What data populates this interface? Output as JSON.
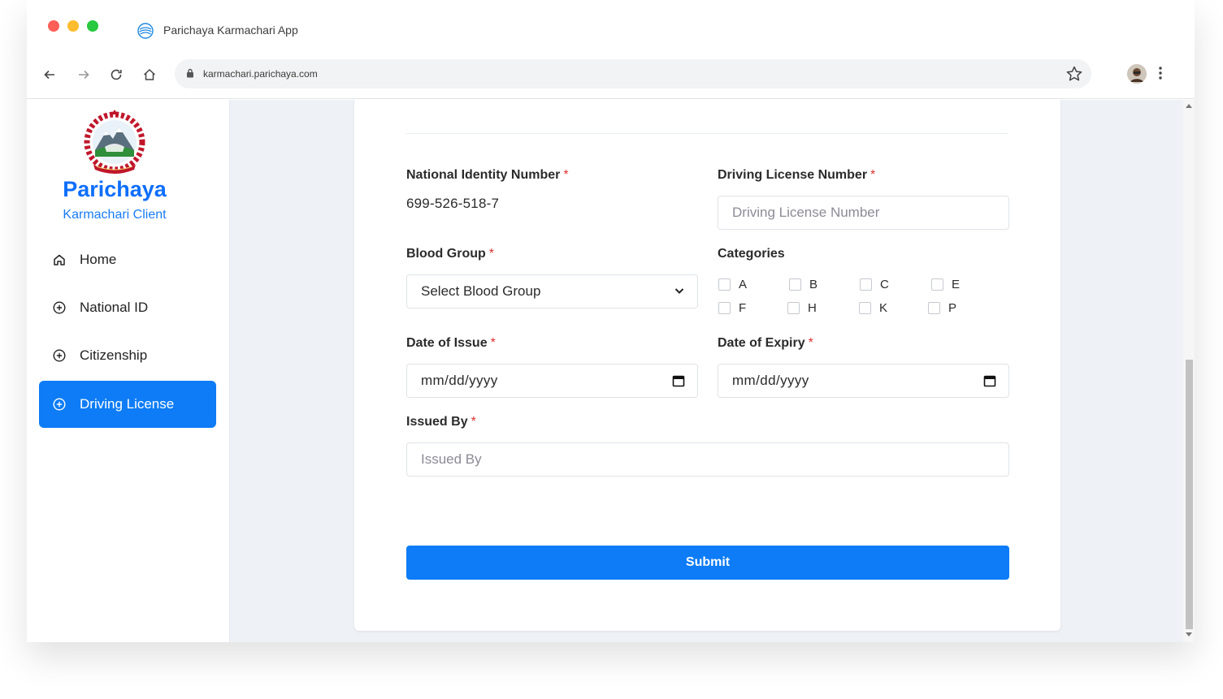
{
  "browser": {
    "tab_title": "Parichaya Karmachari App",
    "url": "karmachari.parichaya.com"
  },
  "sidebar": {
    "brand": "Parichaya",
    "brand_sub": "Karmachari Client",
    "items": [
      {
        "label": "Home",
        "icon": "home-icon",
        "active": false
      },
      {
        "label": "National ID",
        "icon": "plus-circle-icon",
        "active": false
      },
      {
        "label": "Citizenship",
        "icon": "plus-circle-icon",
        "active": false
      },
      {
        "label": "Driving License",
        "icon": "plus-circle-icon",
        "active": true
      }
    ]
  },
  "form": {
    "nin_label": "National Identity Number",
    "nin_value": "699-526-518-7",
    "dl_label": "Driving License Number",
    "dl_placeholder": "Driving License Number",
    "blood_label": "Blood Group",
    "blood_value": "Select Blood Group",
    "categories_label": "Categories",
    "categories": [
      "A",
      "B",
      "C",
      "E",
      "F",
      "H",
      "K",
      "P"
    ],
    "issue_label": "Date of Issue",
    "issue_value": "mm/dd/yyyy",
    "expiry_label": "Date of Expiry",
    "expiry_value": "mm/dd/yyyy",
    "issuedby_label": "Issued By",
    "issuedby_placeholder": "Issued By",
    "required_mark": "*",
    "submit": "Submit"
  },
  "colors": {
    "accent": "#0d7cf6",
    "required": "#e03131",
    "page_bg": "#eef1f6"
  }
}
